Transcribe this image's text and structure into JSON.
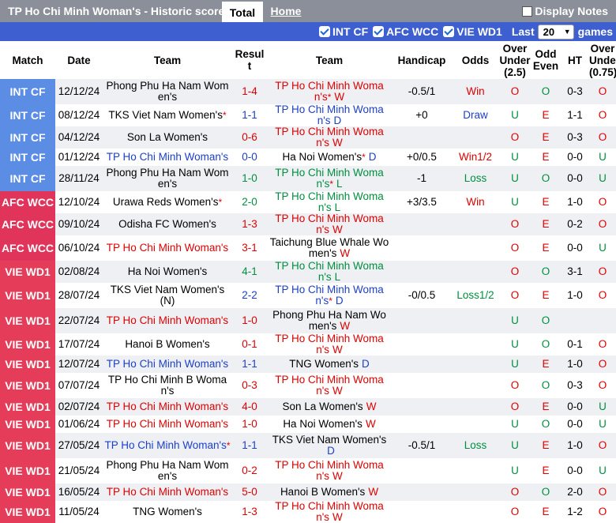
{
  "header": {
    "title": "TP Ho Chi Minh Woman's - Historic scores",
    "tabs": [
      "Total",
      "Home"
    ],
    "display_notes_label": "Display Notes"
  },
  "filters": {
    "items": [
      "INT CF",
      "AFC WCC",
      "VIE WD1"
    ],
    "last_label": "Last",
    "last_value": "20",
    "games_label": "games"
  },
  "columns": {
    "match": "Match",
    "date": "Date",
    "team1": "Team",
    "result_a": "Resul",
    "result_b": "t",
    "team2": "Team",
    "handicap": "Handicap",
    "odds": "Odds",
    "ou25_a": "Over",
    "ou25_b": "Under",
    "ou25_c": "(2.5)",
    "oe_a": "Odd",
    "oe_b": "Even",
    "ht": "HT",
    "ou075_a": "Over",
    "ou075_b": "Under",
    "ou075_c": "(0.75)"
  },
  "rows": [
    {
      "comp": "INT CF",
      "date": "12/12/24",
      "home": "Phong Phu Ha Nam Women's",
      "home_star": false,
      "score": "1-4",
      "away": "TP Ho Chi Minh Woman's",
      "away_star": true,
      "res": "W",
      "hcap": "-0.5/1",
      "odds": "Win",
      "ou": "O",
      "oe": "O",
      "ht": "0-3",
      "ou075": "O"
    },
    {
      "comp": "INT CF",
      "date": "08/12/24",
      "home": "TKS Viet Nam Women's",
      "home_star": true,
      "score": "1-1",
      "away": "TP Ho Chi Minh Woman's",
      "away_star": false,
      "res": "D",
      "hcap": "+0",
      "odds": "Draw",
      "ou": "U",
      "oe": "E",
      "ht": "1-1",
      "ou075": "O"
    },
    {
      "comp": "INT CF",
      "date": "04/12/24",
      "home": "Son La Women's",
      "home_star": false,
      "score": "0-6",
      "away": "TP Ho Chi Minh Woman's",
      "away_star": false,
      "res": "W",
      "hcap": "",
      "odds": "",
      "ou": "O",
      "oe": "E",
      "ht": "0-3",
      "ou075": "O"
    },
    {
      "comp": "INT CF",
      "date": "01/12/24",
      "home": "TP Ho Chi Minh Woman's",
      "home_star": false,
      "score": "0-0",
      "away": "Ha Noi Women's",
      "away_star": true,
      "res": "D",
      "hcap": "+0/0.5",
      "odds": "Win1/2",
      "ou": "U",
      "oe": "E",
      "ht": "0-0",
      "ou075": "U"
    },
    {
      "comp": "INT CF",
      "date": "28/11/24",
      "home": "Phong Phu Ha Nam Women's",
      "home_star": false,
      "score": "1-0",
      "away": "TP Ho Chi Minh Woman's",
      "away_star": true,
      "res": "L",
      "hcap": "-1",
      "odds": "Loss",
      "ou": "U",
      "oe": "O",
      "ht": "0-0",
      "ou075": "U"
    },
    {
      "comp": "AFC WCC",
      "date": "12/10/24",
      "home": "Urawa Reds Women's",
      "home_star": true,
      "score": "2-0",
      "away": "TP Ho Chi Minh Woman's",
      "away_star": false,
      "res": "L",
      "hcap": "+3/3.5",
      "odds": "Win",
      "ou": "U",
      "oe": "E",
      "ht": "1-0",
      "ou075": "O"
    },
    {
      "comp": "AFC WCC",
      "date": "09/10/24",
      "home": "Odisha FC Women's",
      "home_star": false,
      "score": "1-3",
      "away": "TP Ho Chi Minh Woman's",
      "away_star": false,
      "res": "W",
      "hcap": "",
      "odds": "",
      "ou": "O",
      "oe": "E",
      "ht": "0-2",
      "ou075": "O"
    },
    {
      "comp": "AFC WCC",
      "date": "06/10/24",
      "home": "TP Ho Chi Minh Woman's",
      "home_star": false,
      "score": "3-1",
      "away": "Taichung Blue Whale Women's",
      "away_star": false,
      "res": "W",
      "hcap": "",
      "odds": "",
      "ou": "O",
      "oe": "E",
      "ht": "0-0",
      "ou075": "U"
    },
    {
      "comp": "VIE WD1",
      "date": "02/08/24",
      "home": "Ha Noi Women's",
      "home_star": false,
      "score": "4-1",
      "away": "TP Ho Chi Minh Woman's",
      "away_star": false,
      "res": "L",
      "hcap": "",
      "odds": "",
      "ou": "O",
      "oe": "O",
      "ht": "3-1",
      "ou075": "O"
    },
    {
      "comp": "VIE WD1",
      "date": "28/07/24",
      "home": "TKS Viet Nam Women's (N)",
      "home_star": false,
      "score": "2-2",
      "away": "TP Ho Chi Minh Woman's",
      "away_star": true,
      "res": "D",
      "hcap": "-0/0.5",
      "odds": "Loss1/2",
      "ou": "O",
      "oe": "E",
      "ht": "1-0",
      "ou075": "O"
    },
    {
      "comp": "VIE WD1",
      "date": "22/07/24",
      "home": "TP Ho Chi Minh Woman's",
      "home_star": false,
      "score": "1-0",
      "away": "Phong Phu Ha Nam Women's",
      "away_star": false,
      "res": "W",
      "hcap": "",
      "odds": "",
      "ou": "U",
      "oe": "O",
      "ht": "",
      "ou075": ""
    },
    {
      "comp": "VIE WD1",
      "date": "17/07/24",
      "home": "Hanoi B Women's",
      "home_star": false,
      "score": "0-1",
      "away": "TP Ho Chi Minh Woman's",
      "away_star": false,
      "res": "W",
      "hcap": "",
      "odds": "",
      "ou": "U",
      "oe": "O",
      "ht": "0-1",
      "ou075": "O"
    },
    {
      "comp": "VIE WD1",
      "date": "12/07/24",
      "home": "TP Ho Chi Minh Woman's",
      "home_star": false,
      "score": "1-1",
      "away": "TNG Women's",
      "away_star": false,
      "res": "D",
      "hcap": "",
      "odds": "",
      "ou": "U",
      "oe": "E",
      "ht": "1-0",
      "ou075": "O"
    },
    {
      "comp": "VIE WD1",
      "date": "07/07/24",
      "home": "TP Ho Chi Minh B Woman's",
      "home_star": false,
      "score": "0-3",
      "away": "TP Ho Chi Minh Woman's",
      "away_star": false,
      "res": "W",
      "hcap": "",
      "odds": "",
      "ou": "O",
      "oe": "O",
      "ht": "0-3",
      "ou075": "O"
    },
    {
      "comp": "VIE WD1",
      "date": "02/07/24",
      "home": "TP Ho Chi Minh Woman's",
      "home_star": false,
      "score": "4-0",
      "away": "Son La Women's",
      "away_star": false,
      "res": "W",
      "hcap": "",
      "odds": "",
      "ou": "O",
      "oe": "E",
      "ht": "0-0",
      "ou075": "U"
    },
    {
      "comp": "VIE WD1",
      "date": "01/06/24",
      "home": "TP Ho Chi Minh Woman's",
      "home_star": false,
      "score": "1-0",
      "away": "Ha Noi Women's",
      "away_star": false,
      "res": "W",
      "hcap": "",
      "odds": "",
      "ou": "U",
      "oe": "O",
      "ht": "0-0",
      "ou075": "U"
    },
    {
      "comp": "VIE WD1",
      "date": "27/05/24",
      "home": "TP Ho Chi Minh Woman's",
      "home_star": true,
      "score": "1-1",
      "away": "TKS Viet Nam Women's",
      "away_star": false,
      "res": "D",
      "hcap": "-0.5/1",
      "odds": "Loss",
      "ou": "U",
      "oe": "E",
      "ht": "1-0",
      "ou075": "O"
    },
    {
      "comp": "VIE WD1",
      "date": "21/05/24",
      "home": "Phong Phu Ha Nam Women's",
      "home_star": false,
      "score": "0-2",
      "away": "TP Ho Chi Minh Woman's",
      "away_star": false,
      "res": "W",
      "hcap": "",
      "odds": "",
      "ou": "U",
      "oe": "E",
      "ht": "0-0",
      "ou075": "U"
    },
    {
      "comp": "VIE WD1",
      "date": "16/05/24",
      "home": "TP Ho Chi Minh Woman's",
      "home_star": false,
      "score": "5-0",
      "away": "Hanoi B Women's",
      "away_star": false,
      "res": "W",
      "hcap": "",
      "odds": "",
      "ou": "O",
      "oe": "O",
      "ht": "2-0",
      "ou075": "O"
    },
    {
      "comp": "VIE WD1",
      "date": "11/05/24",
      "home": "TNG Women's",
      "home_star": false,
      "score": "1-3",
      "away": "TP Ho Chi Minh Woman's",
      "away_star": false,
      "res": "W",
      "hcap": "",
      "odds": "",
      "ou": "O",
      "oe": "E",
      "ht": "1-2",
      "ou075": "O"
    }
  ],
  "colors": {
    "topbar": "#8a8f99",
    "filterbar": "#3e5fd0",
    "int_cf": "#5b8de5",
    "afc_wcc": "#e0345a",
    "vie_wd1": "#e53c59",
    "win": "#e00000",
    "draw": "#1c3fc9",
    "loss": "#008f3e"
  }
}
